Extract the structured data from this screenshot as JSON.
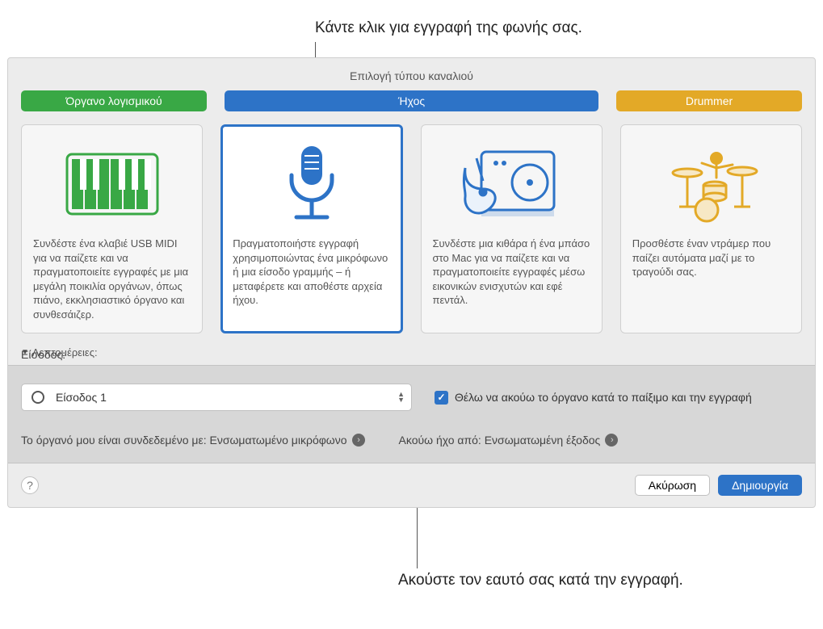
{
  "callouts": {
    "top": "Κάντε κλικ για εγγραφή της φωνής σας.",
    "bottom": "Ακούστε τον εαυτό σας κατά την εγγραφή."
  },
  "pane": {
    "title": "Επιλογή τύπου καναλιού"
  },
  "tabs": {
    "software": "Όργανο λογισμικού",
    "audio": "Ήχος",
    "drummer": "Drummer"
  },
  "cards": {
    "software_desc": "Συνδέστε ένα κλαβιέ USB MIDI για να παίζετε και να πραγματοποιείτε εγγραφές με μια μεγάλη ποικιλία οργάνων, όπως πιάνο, εκκλησιαστικό όργανο και συνθεσάιζερ.",
    "mic_desc": "Πραγματοποιήστε εγγραφή χρησιμοποιώντας ένα μικρόφωνο ή μια είσοδο γραμμής – ή μεταφέρετε και αποθέστε αρχεία ήχου.",
    "guitar_desc": "Συνδέστε μια κιθάρα ή ένα μπάσο στο Mac για να παίζετε και να πραγματοποιείτε εγγραφές μέσω εικονικών ενισχυτών και εφέ πεντάλ.",
    "drummer_desc": "Προσθέστε έναν ντράμερ που παίζει αυτόματα μαζί με το τραγούδι σας."
  },
  "details": {
    "disclosure": "Λεπτομέρειες:",
    "input_label": "Είσοδος:",
    "input_value": "Είσοδος 1",
    "monitor_checkbox": "Θέλω να ακούω το όργανο κατά το παίξιμο και την εγγραφή",
    "connected_label": "Το όργανό μου είναι συνδεδεμένο με: Ενσωματωμένο μικρόφωνο",
    "hear_label": "Ακούω ήχο από: Ενσωματωμένη έξοδος"
  },
  "footer": {
    "cancel": "Ακύρωση",
    "create": "Δημιουργία"
  }
}
